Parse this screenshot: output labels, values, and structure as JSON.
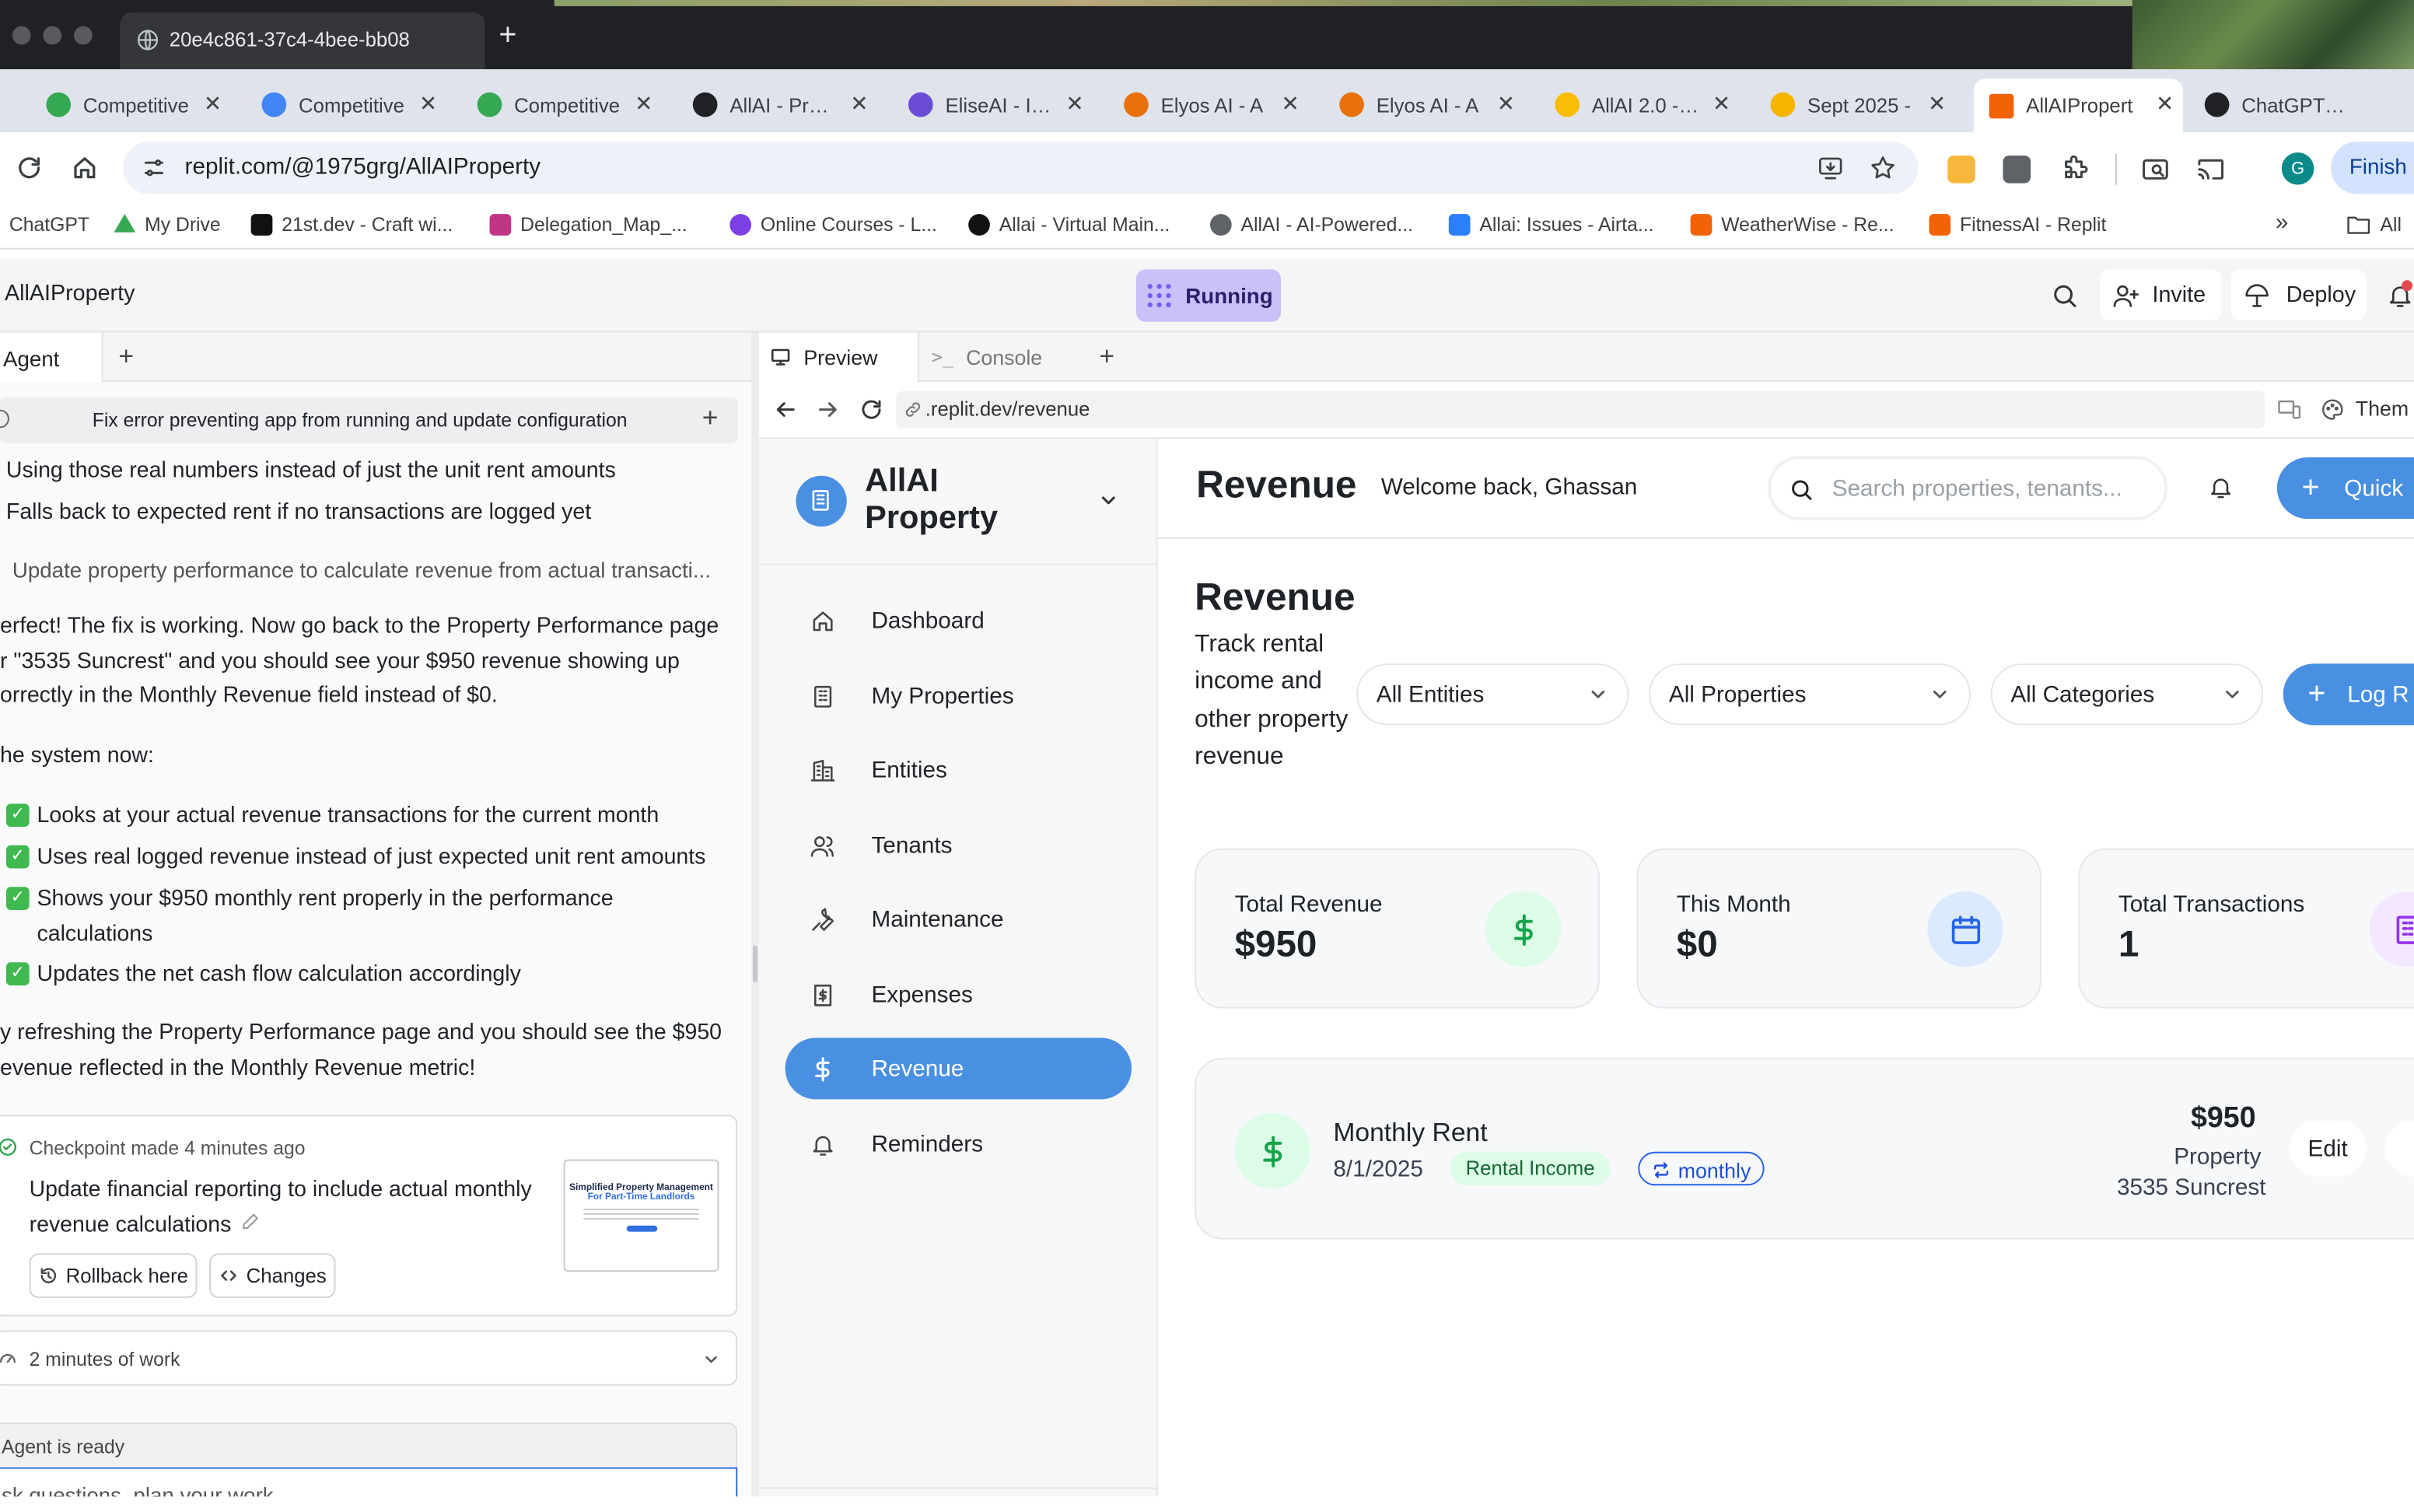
{
  "browser": {
    "active_tab_title": "20e4c861-37c4-4bee-bb08",
    "tabs": [
      {
        "label": "Competitive",
        "color": "#34a853"
      },
      {
        "label": "Competitive",
        "color": "#4285f4"
      },
      {
        "label": "Competitive",
        "color": "#34a853"
      },
      {
        "label": "AllAI - Prope",
        "color": "#202124"
      },
      {
        "label": "EliseAI - Ind",
        "color": "#6a4cd6"
      },
      {
        "label": "Elyos AI - A",
        "color": "#e8710a"
      },
      {
        "label": "Elyos AI - A",
        "color": "#e8710a"
      },
      {
        "label": "AllAI 2.0 - G",
        "color": "#fbbc04"
      },
      {
        "label": "Sept 2025 -",
        "color": "#f4b400"
      },
      {
        "label": "AllAIPropert",
        "color": "#f26207"
      },
      {
        "label": "ChatGPT - A",
        "color": "#202124"
      }
    ],
    "url": "replit.com/@1975grg/AllAIProperty",
    "profile_initial": "G",
    "finish_label": "Finish u",
    "bookmarks": [
      {
        "label": "ChatGPT",
        "color": ""
      },
      {
        "label": "My Drive",
        "color": "#34a853"
      },
      {
        "label": "21st.dev - Craft wi...",
        "color": "#111111"
      },
      {
        "label": "Delegation_Map_...",
        "color": "#c13584"
      },
      {
        "label": "Online Courses - L...",
        "color": "#7b3fe4"
      },
      {
        "label": "Allai - Virtual Main...",
        "color": "#111111"
      },
      {
        "label": "AllAI - AI-Powered...",
        "color": "#5f6368"
      },
      {
        "label": "Allai: Issues - Airta...",
        "color": "#2d7ff9"
      },
      {
        "label": "WeatherWise - Re...",
        "color": "#f26207"
      },
      {
        "label": "FitnessAI - Replit",
        "color": "#f26207"
      }
    ],
    "bookmarks_more": "»",
    "all_bookmarks": "All"
  },
  "replit": {
    "project_name": "AllAIProperty",
    "run_status": "Running",
    "invite_label": "Invite",
    "deploy_label": "Deploy"
  },
  "agent": {
    "tab_label": "Agent",
    "task_title": "Fix error preventing app from running and update configuration",
    "lines_top": [
      "Using those real numbers instead of just the unit rent amounts",
      "Falls back to expected rent if no transactions are logged yet"
    ],
    "step": "Update property performance to calculate revenue from actual transacti...",
    "para1": "erfect! The fix is working. Now go back to the Property Performance page r \"3535 Suncrest\" and you should see your $950 revenue showing up orrectly in the Monthly Revenue field instead of $0.",
    "para2": "he system now:",
    "checks": [
      "Looks at your actual revenue transactions for the current month",
      "Uses real logged revenue instead of just expected unit rent amounts",
      "Shows your $950 monthly rent properly in the performance calculations",
      "Updates the net cash flow calculation accordingly"
    ],
    "para3": "y refreshing the Property Performance page and you should see the $950 evenue reflected in the Monthly Revenue metric!",
    "checkpoint_label": "Checkpoint made",
    "checkpoint_time": "4 minutes ago",
    "checkpoint_text": "Update financial reporting to include actual monthly revenue calculations",
    "rollback_label": "Rollback here",
    "changes_label": "Changes",
    "thumb_title": "Simplified Property Management",
    "thumb_sub": "For Part-Time Landlords",
    "work_time": "2 minutes of work",
    "status": "Agent is ready",
    "input_placeholder": "sk questions, plan your work..."
  },
  "preview": {
    "tab_preview": "Preview",
    "tab_console": "Console",
    "url": ".replit.dev/revenue",
    "theme_label": "Them"
  },
  "app": {
    "brand": "AllAI Property",
    "nav": [
      {
        "label": "Dashboard",
        "icon": "home-icon",
        "selected": false
      },
      {
        "label": "My Properties",
        "icon": "building-icon",
        "selected": false
      },
      {
        "label": "Entities",
        "icon": "office-icon",
        "selected": false
      },
      {
        "label": "Tenants",
        "icon": "users-icon",
        "selected": false
      },
      {
        "label": "Maintenance",
        "icon": "wrench-icon",
        "selected": false
      },
      {
        "label": "Expenses",
        "icon": "receipt-icon",
        "selected": false
      },
      {
        "label": "Revenue",
        "icon": "dollar-icon",
        "selected": true
      },
      {
        "label": "Reminders",
        "icon": "bell-icon",
        "selected": false
      }
    ],
    "header_title": "Revenue",
    "welcome": "Welcome back, Ghassan",
    "search_placeholder": "Search properties, tenants...",
    "quick_label": "Quick",
    "page_title": "Revenue",
    "page_sub": "Track rental income and other property revenue",
    "filters": [
      "All Entities",
      "All Properties",
      "All Categories"
    ],
    "log_label": "Log R",
    "stats": [
      {
        "label": "Total Revenue",
        "value": "$950",
        "icon": "dollar-icon",
        "color": "#16a34a",
        "bg": "#dcfce7"
      },
      {
        "label": "This Month",
        "value": "$0",
        "icon": "calendar-icon",
        "color": "#2563eb",
        "bg": "#dbeafe"
      },
      {
        "label": "Total Transactions",
        "value": "1",
        "icon": "building-icon",
        "color": "#9333ea",
        "bg": "#f3e8ff"
      }
    ],
    "entry": {
      "title": "Monthly Rent",
      "date": "8/1/2025",
      "category": "Rental Income",
      "frequency": "monthly",
      "amount": "$950",
      "scope": "Property",
      "property": "3535 Suncrest",
      "edit_label": "Edit"
    }
  }
}
